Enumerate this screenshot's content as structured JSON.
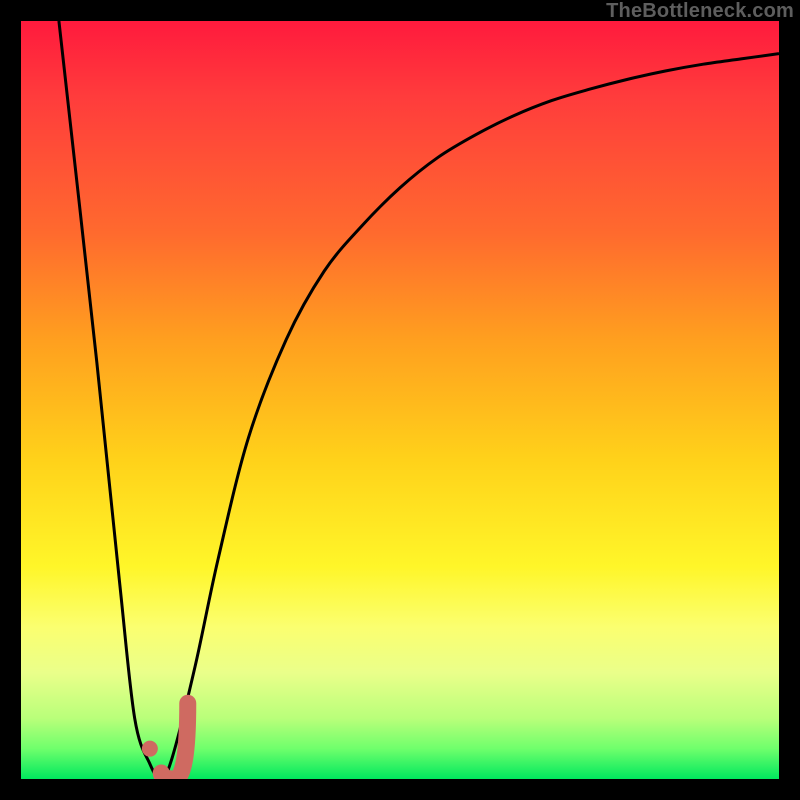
{
  "watermark": "TheBottleneck.com",
  "colors": {
    "curve": "#000000",
    "marker_stroke": "#cf6a61",
    "marker_fill": "#cf6a61",
    "frame": "#000000"
  },
  "chart_data": {
    "type": "line",
    "title": "",
    "xlabel": "",
    "ylabel": "",
    "xlim": [
      0,
      100
    ],
    "ylim": [
      0,
      100
    ],
    "grid": false,
    "legend": false,
    "series": [
      {
        "name": "bottleneck-curve",
        "x": [
          5,
          10,
          13,
          15,
          17,
          18.5,
          20,
          23,
          26,
          30,
          35,
          40,
          45,
          50,
          55,
          60,
          65,
          70,
          75,
          80,
          85,
          90,
          95,
          100
        ],
        "values": [
          100,
          55,
          26,
          8,
          2,
          0,
          3,
          15,
          29,
          45,
          58,
          67,
          73,
          78,
          82,
          85,
          87.5,
          89.5,
          91,
          92.3,
          93.4,
          94.3,
          95,
          95.7
        ]
      }
    ],
    "annotations": [
      {
        "name": "optimum-dot",
        "x": 17,
        "y": 4
      },
      {
        "name": "optimum-hook",
        "x_range": [
          18.5,
          22
        ],
        "y_start": 0,
        "y_end": 10
      }
    ],
    "notes": "Values estimated from pixel positions; x is normalized 0–100 left→right, y is normalized 0–100 bottom→top (100 = top of gradient area)."
  }
}
